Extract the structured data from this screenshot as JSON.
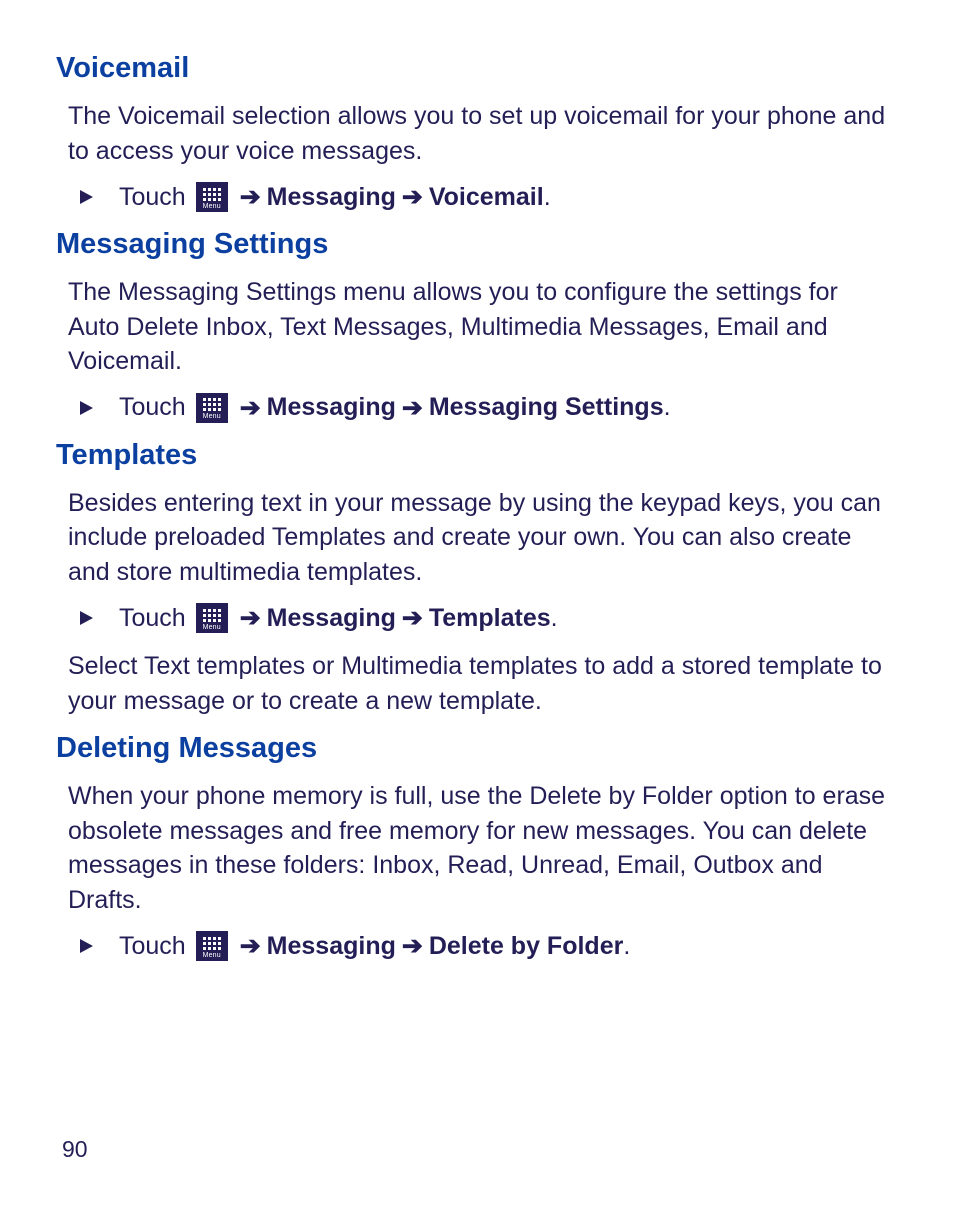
{
  "common": {
    "touch": "Touch",
    "arrow": "➔",
    "menuLabel": "Menu",
    "messaging": "Messaging"
  },
  "sections": {
    "voicemail": {
      "heading": "Voicemail",
      "body": "The Voicemail selection allows you to set up voicemail for your phone and to access your voice messages.",
      "target": "Voicemail"
    },
    "messagingSettings": {
      "heading": "Messaging Settings",
      "body": "The Messaging Settings menu allows you to configure the settings for Auto Delete Inbox, Text Messages, Multimedia Messages, Email and Voicemail.",
      "target": "Messaging Settings"
    },
    "templates": {
      "heading": "Templates",
      "body1": "Besides entering text in your message by using the keypad keys, you can include preloaded Templates and create your own. You can also create and store multimedia templates.",
      "target": "Templates",
      "body2": "Select Text templates or Multimedia templates to add a stored template to your message or to create a new template."
    },
    "deleting": {
      "heading": "Deleting Messages",
      "body": "When your phone memory is full, use the Delete by Folder option to erase obsolete messages and free memory for new messages. You can delete messages in these folders: Inbox, Read, Unread, Email, Outbox and Drafts.",
      "target": "Delete by Folder"
    }
  },
  "pageNumber": "90"
}
